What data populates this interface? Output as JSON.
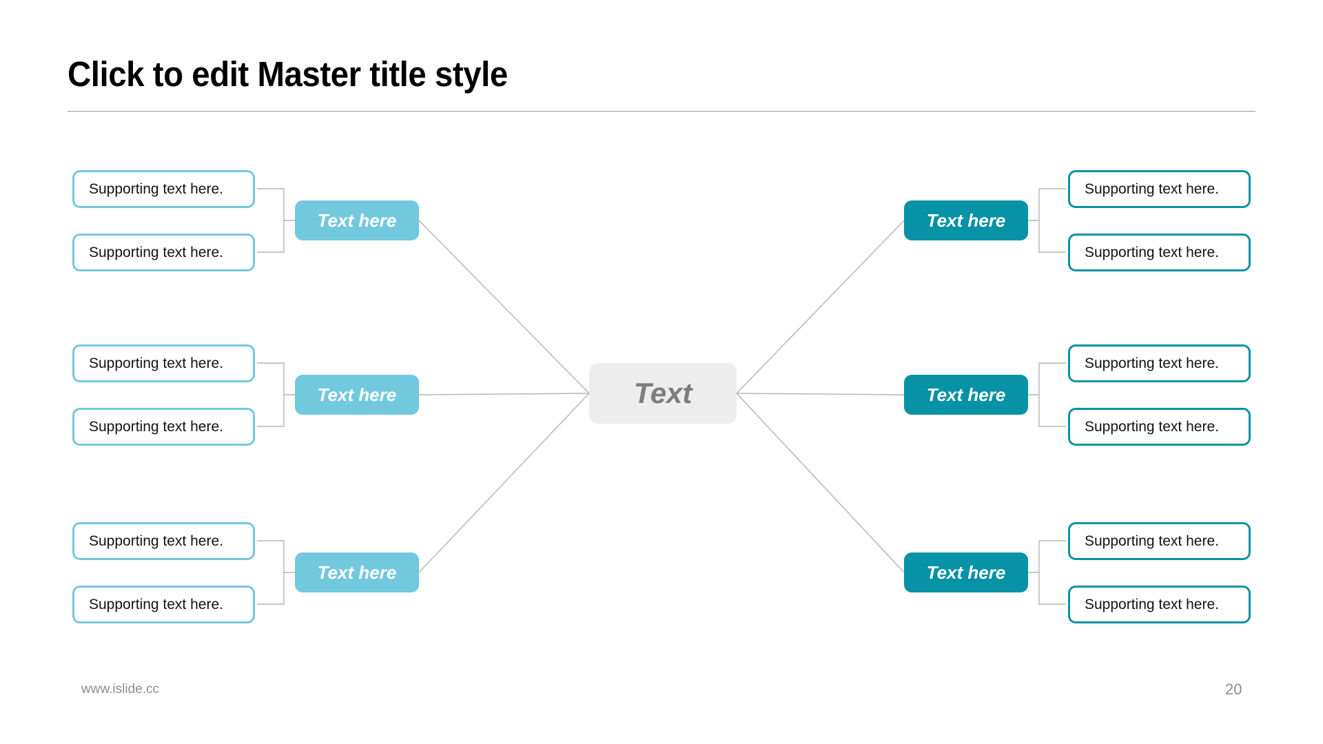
{
  "slide": {
    "title": "Click to edit Master title style",
    "center_label": "Text",
    "footer_url": "www.islide.cc",
    "page_number": "20"
  },
  "colors": {
    "light_blue": "#72c9de",
    "teal": "#0892a5",
    "center_gray": "#ededed",
    "center_text": "#7d7d7d",
    "connector": "#b3b3b3",
    "rule": "#9a9a9a",
    "footer_text": "#8c8c8c"
  },
  "branches": {
    "left": [
      {
        "label": "Text here",
        "supports": [
          "Supporting text here.",
          "Supporting text here."
        ]
      },
      {
        "label": "Text here",
        "supports": [
          "Supporting text here.",
          "Supporting text here."
        ]
      },
      {
        "label": "Text here",
        "supports": [
          "Supporting text here.",
          "Supporting text here."
        ]
      }
    ],
    "right": [
      {
        "label": "Text here",
        "supports": [
          "Supporting text here.",
          "Supporting text here."
        ]
      },
      {
        "label": "Text here",
        "supports": [
          "Supporting text here.",
          "Supporting text here."
        ]
      },
      {
        "label": "Text here",
        "supports": [
          "Supporting text here.",
          "Supporting text here."
        ]
      }
    ]
  }
}
